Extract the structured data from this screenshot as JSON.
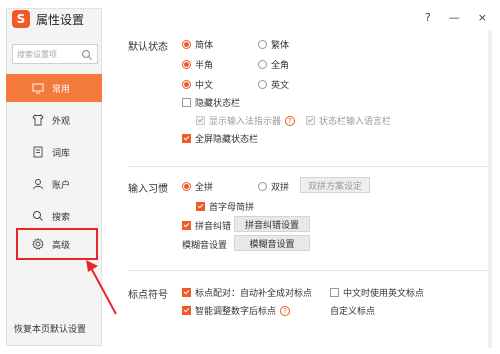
{
  "app": {
    "title": "属性设置",
    "logo_char": "S"
  },
  "window_controls": {
    "help": "?",
    "minimize": "—",
    "close": "×"
  },
  "search": {
    "placeholder": "搜索设置项"
  },
  "sidebar": {
    "items": [
      {
        "label": "常用",
        "icon": "monitor-icon"
      },
      {
        "label": "外观",
        "icon": "shirt-icon"
      },
      {
        "label": "词库",
        "icon": "book-icon"
      },
      {
        "label": "账户",
        "icon": "user-icon"
      },
      {
        "label": "搜索",
        "icon": "search-icon"
      },
      {
        "label": "高级",
        "icon": "gear-icon"
      }
    ],
    "restore_label": "恢复本页默认设置"
  },
  "default_state": {
    "label": "默认状态",
    "simplified": "简体",
    "traditional": "繁体",
    "halfwidth": "半角",
    "fullwidth": "全角",
    "chinese": "中文",
    "english": "英文",
    "hide_status_bar": "隐藏状态栏",
    "show_indicator": "显示输入法指示器",
    "status_bar_lang": "状态栏输入语言栏",
    "fullscreen_hide": "全屏隐藏状态栏"
  },
  "input_habit": {
    "label": "输入习惯",
    "full_pinyin": "全拼",
    "double_pinyin": "双拼",
    "double_scheme_btn": "双拼方案设定",
    "initial_letters": "首字母简拼",
    "pinyin_correction": "拼音纠错",
    "pinyin_correction_btn": "拼音纠错设置",
    "fuzzy_label": "模糊音设置",
    "fuzzy_btn": "模糊音设置"
  },
  "punctuation": {
    "label": "标点符号",
    "pairing": "标点配对：自动补全成对标点",
    "english_punct_in_chinese": "中文时使用英文标点",
    "smart_adjust": "智能调整数字后标点",
    "custom_label": "自定义标点"
  },
  "colors": {
    "accent": "#f05a28",
    "sidebar_active": "#f47a3b",
    "highlight": "#e8262a"
  }
}
